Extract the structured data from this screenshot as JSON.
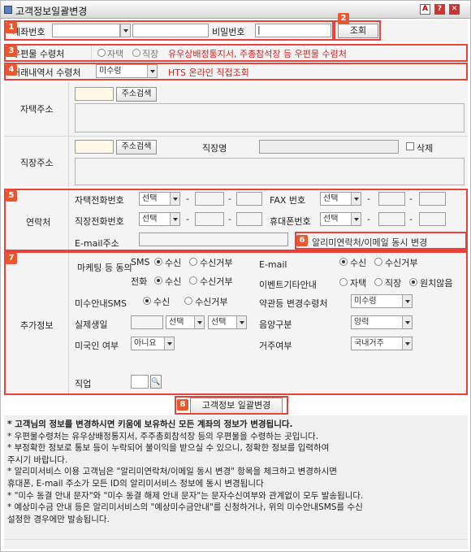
{
  "window": {
    "title": "고객정보일괄변경",
    "icons": [
      "lock-icon",
      "help-icon",
      "close-icon"
    ]
  },
  "account": {
    "label": "계좌번호",
    "password_label": "비밀번호",
    "password_value": "|",
    "query_button": "조회"
  },
  "mail": {
    "label": "우편물 수령처",
    "opt_home": "자택",
    "opt_work": "직장",
    "note": "유우상배정통지서, 주총참석장 등 우편물 수령처"
  },
  "statement": {
    "label": "거래내역서 수령처",
    "select": "미수령",
    "note": "HTS 온라인 직접조회"
  },
  "home_address": {
    "label": "자택주소",
    "search": "주소검색"
  },
  "work_address": {
    "label": "직장주소",
    "search": "주소검색",
    "company_label": "직장명",
    "delete_label": "삭제"
  },
  "contact": {
    "label": "연락처",
    "home_phone": "자택전화번호",
    "fax": "FAX 번호",
    "work_phone": "직장전화번호",
    "mobile": "휴대폰번호",
    "email": "E-mail주소",
    "select": "선택",
    "dash": "-",
    "sync_label": "알리미연락처/이메일 동시 변경"
  },
  "extra": {
    "label": "추가정보",
    "marketing": "마케팅 등 동의",
    "sms": "SMS",
    "phone": "전화",
    "email": "E-mail",
    "event": "이벤트기타안내",
    "receive": "수신",
    "reject": "수신거부",
    "home": "자택",
    "work": "직장",
    "none": "원치않음",
    "misu_sms": "미수안내SMS",
    "terms": "약관등 변경수령처",
    "terms_value": "미수령",
    "birthday": "실제생일",
    "select": "선택",
    "lunar": "음양구분",
    "lunar_value": "양력",
    "us": "미국인 여부",
    "us_value": "아니요",
    "residence": "거주여부",
    "residence_value": "국내거주",
    "job": "직업"
  },
  "bulk_button": "고객정보 일괄변경",
  "markers": [
    "1",
    "2",
    "3",
    "4",
    "5",
    "6",
    "7",
    "8"
  ],
  "notes": {
    "bold": "* 고객님의 정보를 변경하시면 키움에 보유하신 모든 계좌의 정보가 변경됩니다.",
    "lines": [
      "* 우편물수령처는 유우상배정통지서, 주주총회참석장 등의 우편물을 수령하는 곳입니다.",
      "* 부정확한 정보로 통보 등이 누락되어 불이익을 받으실 수 있으니, 정확한 정보를 입력하여",
      "   주시기 바랍니다.",
      "* 알리미서비스 이용 고객님은 \"알리미연락처/이메일 동시 변경\" 항목을 체크하고 변경하시면",
      "   휴대폰, E-mail 주소가 모든 ID의 알리미서비스 정보에 동시 변경됩니다",
      "* \"미수 동결 안내 문자\"와 \"미수 동결 해제 안내 문자\"는 문자수신여부와 관계없이 모두 발송됩니다.",
      "* 예상미수금 안내 등은 알리미서비스의 \"예상미수금안내\"를 신청하거나, 위의 미수안내SMS를 수신",
      "   설정한 경우에만 발송됩니다."
    ]
  }
}
